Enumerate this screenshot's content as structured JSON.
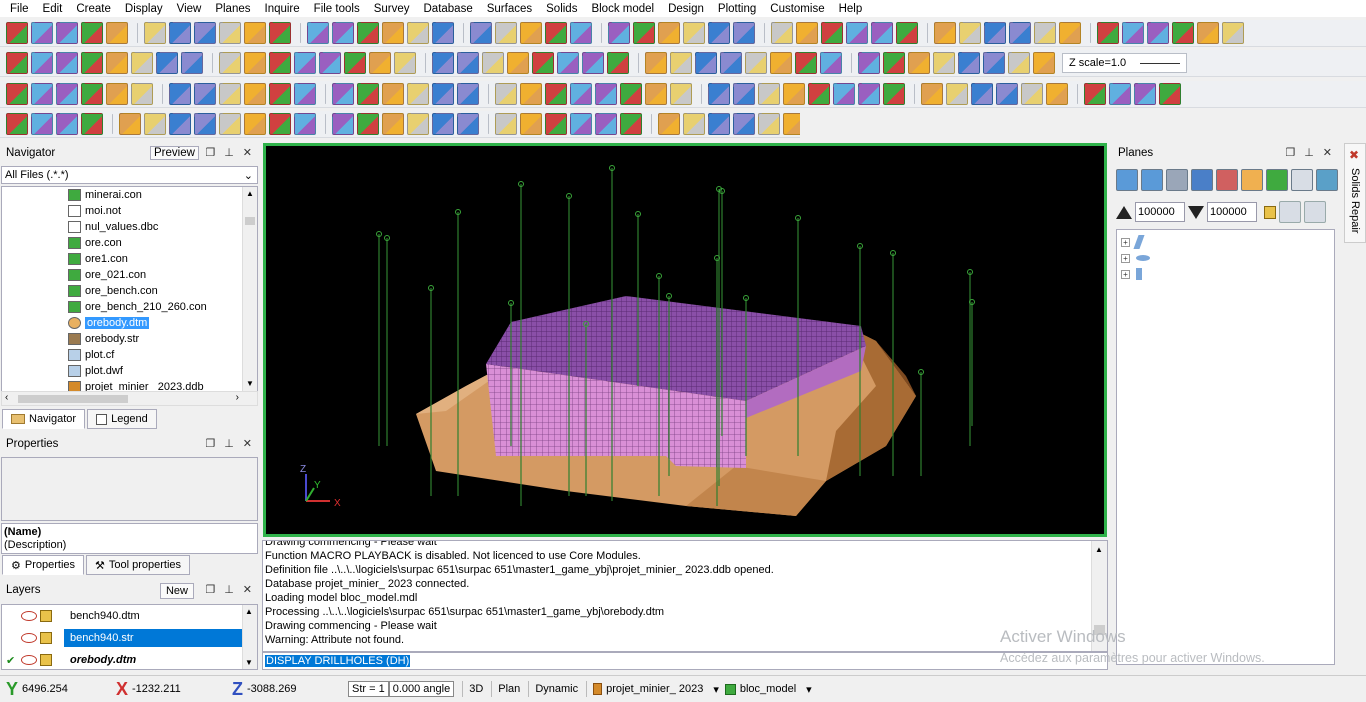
{
  "menu": [
    "File",
    "Edit",
    "Create",
    "Display",
    "View",
    "Planes",
    "Inquire",
    "File tools",
    "Survey",
    "Database",
    "Surfaces",
    "Solids",
    "Block model",
    "Design",
    "Plotting",
    "Customise",
    "Help"
  ],
  "toolbar": {
    "zscale_label": "Z scale=1.0"
  },
  "navigator": {
    "title": "Navigator",
    "preview_label": "Preview",
    "filter": "All Files (.*.*)",
    "files": [
      {
        "name": "minerai.con",
        "icon": "block-model-icon"
      },
      {
        "name": "moi.not",
        "icon": "document-icon"
      },
      {
        "name": "nul_values.dbc",
        "icon": "document-icon"
      },
      {
        "name": "ore.con",
        "icon": "block-model-icon"
      },
      {
        "name": "ore1.con",
        "icon": "block-model-icon"
      },
      {
        "name": "ore_021.con",
        "icon": "block-model-icon"
      },
      {
        "name": "ore_bench.con",
        "icon": "block-model-icon"
      },
      {
        "name": "ore_bench_210_260.con",
        "icon": "block-model-icon"
      },
      {
        "name": "orebody.dtm",
        "icon": "dtm-icon"
      },
      {
        "name": "orebody.str",
        "icon": "string-icon"
      },
      {
        "name": "plot.cf",
        "icon": "plot-icon"
      },
      {
        "name": "plot.dwf",
        "icon": "plot-icon"
      },
      {
        "name": "projet_minier_ 2023.ddb",
        "icon": "database-icon"
      }
    ],
    "selected_file": "orebody.dtm",
    "tabs": [
      "Navigator",
      "Legend"
    ]
  },
  "properties": {
    "title": "Properties",
    "name_label": "(Name)",
    "description_label": "(Description)",
    "tabs": [
      "Properties",
      "Tool properties"
    ]
  },
  "layers": {
    "title": "Layers",
    "new_label": "New",
    "items": [
      {
        "name": "bench940.dtm",
        "checked": false,
        "selected": false,
        "bold": false
      },
      {
        "name": "bench940.str",
        "checked": false,
        "selected": true,
        "bold": false
      },
      {
        "name": "orebody.dtm",
        "checked": true,
        "selected": false,
        "bold": true
      }
    ]
  },
  "viewport": {
    "background": "#000000",
    "border_color": "#2fb24a",
    "axis_labels": [
      "Z",
      "Y",
      "X"
    ]
  },
  "console": {
    "lines": [
      "Drawing commencing - Please wait",
      "Function MACRO PLAYBACK is disabled. Not licenced to use Core Modules.",
      "Definition file ..\\..\\..\\logiciels\\surpac 651\\surpac 651\\master1_game_ybj\\projet_minier_ 2023.ddb opened.",
      "Database projet_minier_ 2023 connected.",
      "Loading model bloc_model.mdl",
      "Processing ..\\..\\..\\logiciels\\surpac 651\\surpac 651\\master1_game_ybj\\orebody.dtm",
      "Drawing commencing - Please wait",
      "Warning: Attribute  not found."
    ],
    "command": "DISPLAY DRILLHOLES (DH)"
  },
  "planes": {
    "title": "Planes",
    "value_a": "100000",
    "value_b": "100000"
  },
  "side_tab": "Solids Repair",
  "watermark": {
    "line1": "Activer Windows",
    "line2": "Accédez aux paramètres pour activer Windows."
  },
  "status": {
    "y": "6496.254",
    "x": "-1232.211",
    "z": "-3088.269",
    "str_label": "Str = 1",
    "angle": "0.000 angle",
    "mode_3d": "3D",
    "mode_plan": "Plan",
    "mode_dynamic": "Dynamic",
    "database": "projet_minier_ 2023",
    "block_model": "bloc_model"
  },
  "colors": {
    "accent_select": "#0078d7",
    "ore_block": "#d98fd6",
    "ore_block_top": "#8a4fa8",
    "surface": "#d79f6a",
    "drillhole": "#2f7f2f"
  }
}
